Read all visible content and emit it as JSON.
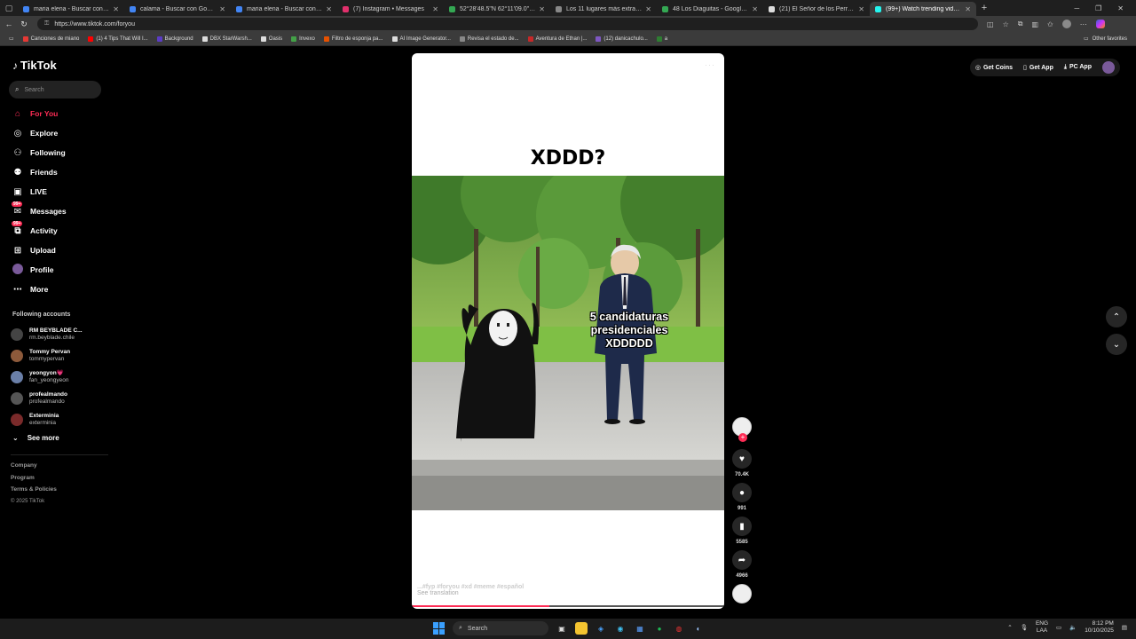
{
  "browser": {
    "tabs": [
      {
        "title": "maria elena - Buscar con Google",
        "favicon_color": "#4285f4"
      },
      {
        "title": "calama - Buscar con Google",
        "favicon_color": "#4285f4"
      },
      {
        "title": "maria elena - Buscar con Google",
        "favicon_color": "#4285f4"
      },
      {
        "title": "(7) Instagram • Messages",
        "favicon_color": "#e1306c"
      },
      {
        "title": "52°28'48.5\"N 62°11'09.0\"E - Goo...",
        "favicon_color": "#34a853"
      },
      {
        "title": "Los 11 lugares más extraños que...",
        "favicon_color": "#888888"
      },
      {
        "title": "48 Los Diaguitas - Google Maps",
        "favicon_color": "#34a853"
      },
      {
        "title": "(21) El Señor de los Perros en X:...",
        "favicon_color": "#dddddd"
      },
      {
        "title": "(99+) Watch trending videos...",
        "favicon_color": "#25f4ee"
      }
    ],
    "active_tab_index": 8,
    "url": "https://www.tiktok.com/foryou",
    "bookmarks": [
      {
        "label": "Canciones de miano",
        "color": "#e53935"
      },
      {
        "label": "(1) 4 Tips That Will I...",
        "color": "#ff0000"
      },
      {
        "label": "Background",
        "color": "#5b3cc4"
      },
      {
        "label": "DBX StarWarsh...",
        "color": "#dddddd"
      },
      {
        "label": "Oasis",
        "color": "#dddddd"
      },
      {
        "label": "Invexo",
        "color": "#43a047"
      },
      {
        "label": "Filtro de esponja pa...",
        "color": "#e65100"
      },
      {
        "label": "AI Image Generator...",
        "color": "#dddddd"
      },
      {
        "label": "Revisa el estado de...",
        "color": "#888888"
      },
      {
        "label": "Aventura de Ethan |...",
        "color": "#c62828"
      },
      {
        "label": "(12) danicachulo...",
        "color": "#7e57c2"
      },
      {
        "label": "a",
        "color": "#2e7d32"
      }
    ],
    "other_favorites": "Other favorites"
  },
  "sidebar": {
    "logo": "TikTok",
    "search_placeholder": "Search",
    "nav": [
      {
        "label": "For You",
        "icon": "home-icon",
        "active": true,
        "badge": ""
      },
      {
        "label": "Explore",
        "icon": "compass-icon",
        "active": false,
        "badge": ""
      },
      {
        "label": "Following",
        "icon": "following-icon",
        "active": false,
        "badge": ""
      },
      {
        "label": "Friends",
        "icon": "friends-icon",
        "active": false,
        "badge": ""
      },
      {
        "label": "LIVE",
        "icon": "live-icon",
        "active": false,
        "badge": ""
      },
      {
        "label": "Messages",
        "icon": "messages-icon",
        "active": false,
        "badge": "99+"
      },
      {
        "label": "Activity",
        "icon": "activity-icon",
        "active": false,
        "badge": "99+"
      },
      {
        "label": "Upload",
        "icon": "upload-icon",
        "active": false,
        "badge": ""
      },
      {
        "label": "Profile",
        "icon": "profile-avatar",
        "active": false,
        "badge": ""
      },
      {
        "label": "More",
        "icon": "more-icon",
        "active": false,
        "badge": ""
      }
    ],
    "following_heading": "Following accounts",
    "accounts": [
      {
        "name": "RM BEYBLADE C...",
        "handle": "rm.beyblade.chile",
        "color": "#444444"
      },
      {
        "name": "Tommy Pervan",
        "handle": "tommypervan",
        "color": "#8d5a3b"
      },
      {
        "name": "yeongyon💗",
        "handle": "fan_yeongyeon",
        "color": "#6a7fa8"
      },
      {
        "name": "profealmando",
        "handle": "profealmando",
        "color": "#555555"
      },
      {
        "name": "Exterminia",
        "handle": "exterminia",
        "color": "#7a2a2a"
      }
    ],
    "see_more": "See more",
    "footer": [
      "Company",
      "Program",
      "Terms & Policies"
    ],
    "copyright": "© 2025 TikTok"
  },
  "topbar": {
    "get_coins": "Get Coins",
    "get_app": "Get App",
    "pc_app": "PC App"
  },
  "video": {
    "caption": "XDDD?",
    "overlay_text_lines": [
      "5 candidaturas",
      "presidenciales",
      "XDDDDD"
    ],
    "description_tags": "...#fyp #foryou #xd #meme #español",
    "see_translation": "See translation",
    "progress": 0.44,
    "likes": "70.4K",
    "comments": "991",
    "saves": "5585",
    "shares": "4966"
  },
  "taskbar": {
    "search_placeholder": "Search",
    "language": "ENG",
    "layout": "LAA",
    "time": "8:12 PM",
    "date": "10/10/2025"
  }
}
